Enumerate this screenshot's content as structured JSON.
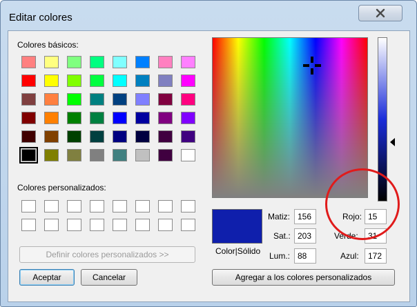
{
  "window": {
    "title": "Editar colores",
    "close_icon": "close-icon"
  },
  "basic_colors": {
    "label": "Colores básicos:",
    "swatches": [
      "#ff8080",
      "#ffff80",
      "#80ff80",
      "#00ff80",
      "#80ffff",
      "#0080ff",
      "#ff80c0",
      "#ff80ff",
      "#ff0000",
      "#ffff00",
      "#80ff00",
      "#00ff40",
      "#00ffff",
      "#0080c0",
      "#8080c0",
      "#ff00ff",
      "#804040",
      "#ff8040",
      "#00ff00",
      "#008080",
      "#004080",
      "#8080ff",
      "#800040",
      "#ff0080",
      "#800000",
      "#ff8000",
      "#008000",
      "#008040",
      "#0000ff",
      "#0000a0",
      "#800080",
      "#8000ff",
      "#400000",
      "#804000",
      "#004000",
      "#004040",
      "#000080",
      "#000040",
      "#400040",
      "#400080",
      "#000000",
      "#808000",
      "#808040",
      "#808080",
      "#408080",
      "#c0c0c0",
      "#400040",
      "#ffffff"
    ],
    "selected_index": 40
  },
  "custom_colors": {
    "label": "Colores personalizados:"
  },
  "buttons": {
    "define_custom": "Definir colores personalizados >>",
    "ok": "Aceptar",
    "cancel": "Cancelar",
    "add_custom": "Agregar a los colores personalizados"
  },
  "preview": {
    "label": "Color|Sólido",
    "color": "#0f1fac"
  },
  "hsl": {
    "hue_label": "Matiz:",
    "hue": "156",
    "sat_label": "Sat.:",
    "sat": "203",
    "lum_label": "Lum.:",
    "lum": "88"
  },
  "rgb": {
    "red_label": "Rojo:",
    "red": "15",
    "green_label": "Verde:",
    "green": "31",
    "blue_label": "Azul:",
    "blue": "172"
  },
  "annotation_color": "#e01b1b"
}
